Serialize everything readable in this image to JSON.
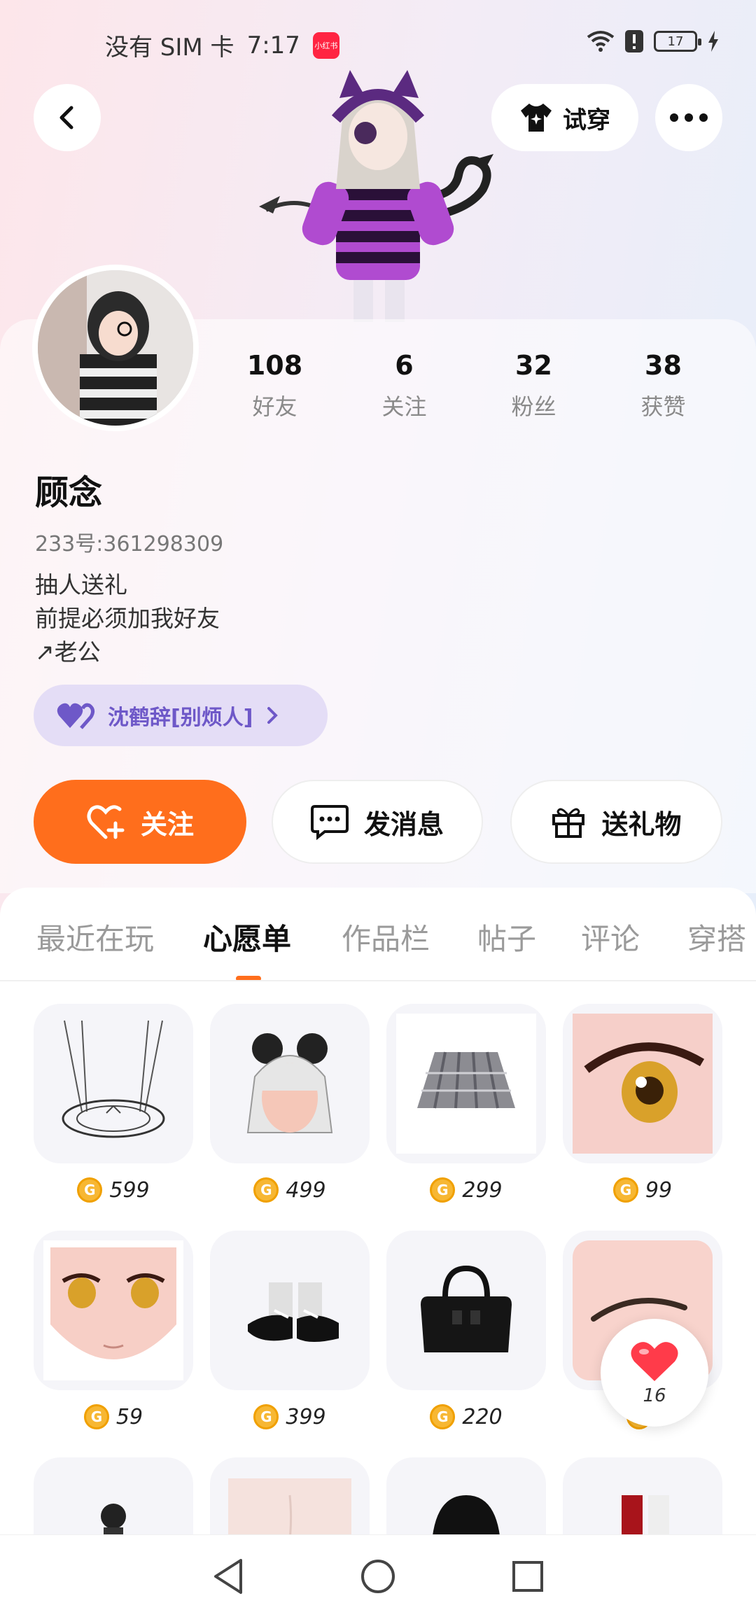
{
  "status_bar": {
    "carrier": "没有 SIM 卡",
    "time": "7:17",
    "app_badge": "小红书",
    "battery": "17"
  },
  "header": {
    "try_on_label": "试穿"
  },
  "profile": {
    "stats": [
      {
        "value": "108",
        "label": "好友"
      },
      {
        "value": "6",
        "label": "关注"
      },
      {
        "value": "32",
        "label": "粉丝"
      },
      {
        "value": "38",
        "label": "获赞"
      }
    ],
    "name": "顾念",
    "id_text": "233号:361298309",
    "bio_lines": [
      "抽人送礼",
      "前提必须加我好友",
      "↗老公"
    ],
    "cp_tag": "沈鹤辞[别烦人]"
  },
  "actions": {
    "follow": "关注",
    "message": "发消息",
    "gift": "送礼物"
  },
  "tabs": [
    "最近在玩",
    "心愿单",
    "作品栏",
    "帖子",
    "评论",
    "穿搭"
  ],
  "active_tab": "心愿单",
  "wishlist": [
    {
      "kind": "pendant",
      "price": "599"
    },
    {
      "kind": "hair",
      "price": "499"
    },
    {
      "kind": "skirt",
      "price": "299"
    },
    {
      "kind": "eye",
      "price": "99"
    },
    {
      "kind": "face",
      "price": "59"
    },
    {
      "kind": "shoes",
      "price": "399"
    },
    {
      "kind": "bag",
      "price": "220"
    },
    {
      "kind": "brow",
      "price": ""
    }
  ],
  "like_float": {
    "count": "16"
  },
  "colors": {
    "accent": "#ff6e1c",
    "cp_tag_bg": "#e4ddf6",
    "cp_tag_text": "#6e58c8"
  }
}
